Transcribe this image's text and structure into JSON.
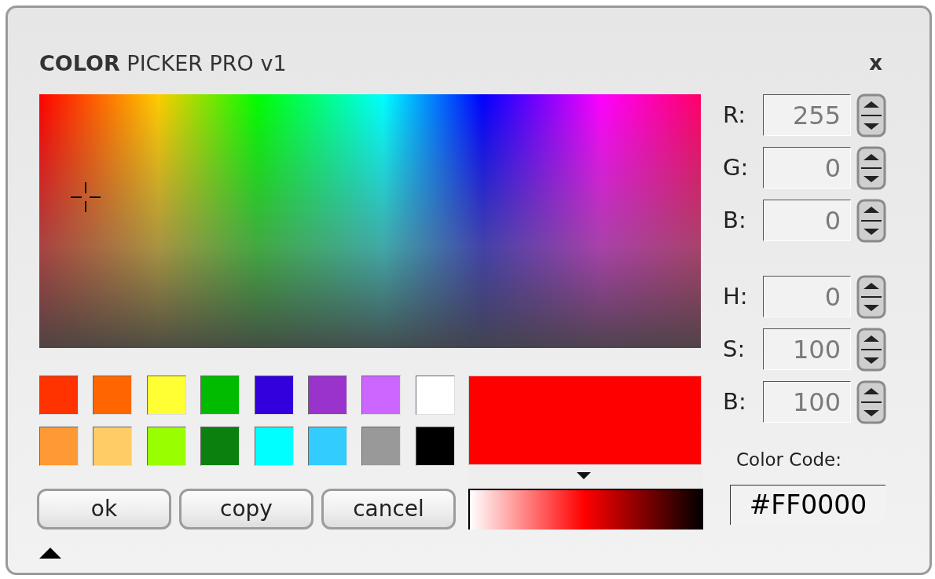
{
  "dialog": {
    "title": "**COLOR** PICKER PRO v1",
    "close": "x"
  },
  "swatches": [
    {
      "color": "#ff3300"
    },
    {
      "color": "#ff6600"
    },
    {
      "color": "#ffff33"
    },
    {
      "color": "#00bb00"
    },
    {
      "color": "#3300dd"
    },
    {
      "color": "#9933cc"
    },
    {
      "color": "#cc66ff"
    },
    {
      "color": "#ffffff"
    },
    {
      "color": "#ff9933"
    },
    {
      "color": "#ffcc66"
    },
    {
      "color": "#99ff00"
    },
    {
      "color": "#0a800f"
    },
    {
      "color": "#00ffff"
    },
    {
      "color": "#33ccff"
    },
    {
      "color": "#999999"
    },
    {
      "color": "#000000"
    }
  ],
  "preview": {
    "color": "#ff0000"
  },
  "shade": {
    "level": 0.49
  },
  "buttons": [
    "ok",
    "copy",
    "cancel"
  ],
  "rgb_fields": [
    {
      "label": "R:",
      "value": "255"
    },
    {
      "label": "G:",
      "value": "0"
    },
    {
      "label": "B:",
      "value": "0"
    }
  ],
  "hsb_fields": [
    {
      "label": "H:",
      "value": "0"
    },
    {
      "label": "S:",
      "value": "100"
    },
    {
      "label": "B:",
      "value": "100"
    }
  ],
  "color_code": {
    "label": "Color Code:",
    "value": "#FF0000"
  }
}
